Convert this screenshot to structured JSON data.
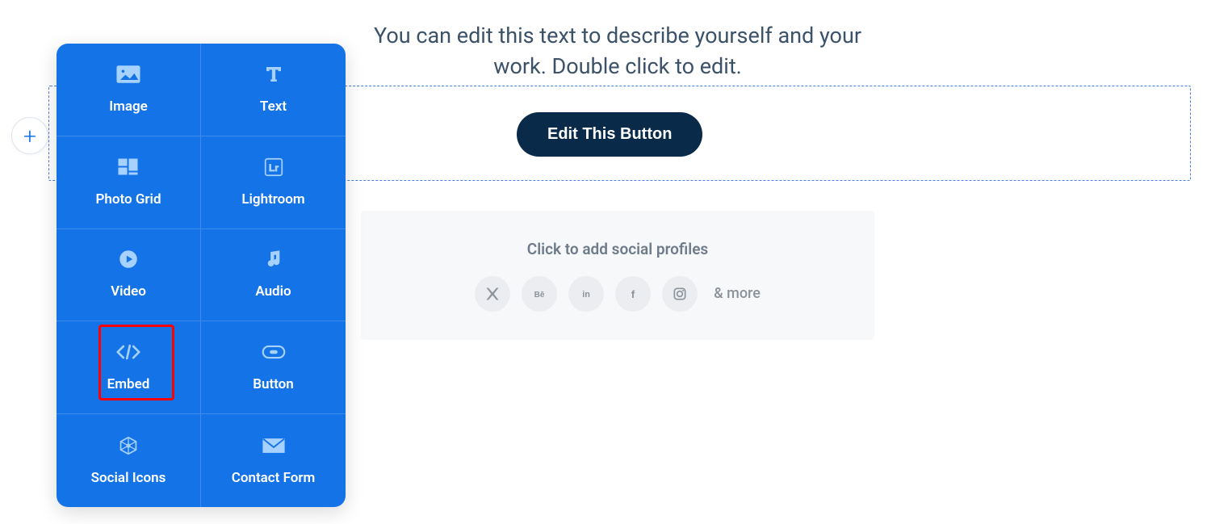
{
  "panel": {
    "items": [
      {
        "label": "Image",
        "icon": "image"
      },
      {
        "label": "Text",
        "icon": "text"
      },
      {
        "label": "Photo Grid",
        "icon": "grid"
      },
      {
        "label": "Lightroom",
        "icon": "lightroom"
      },
      {
        "label": "Video",
        "icon": "video"
      },
      {
        "label": "Audio",
        "icon": "audio"
      },
      {
        "label": "Embed",
        "icon": "embed",
        "highlighted": true
      },
      {
        "label": "Button",
        "icon": "button"
      },
      {
        "label": "Social Icons",
        "icon": "social"
      },
      {
        "label": "Contact Form",
        "icon": "contact"
      }
    ]
  },
  "main": {
    "description": "You can edit this text to describe yourself and your work. Double click to edit.",
    "button_label": "Edit This Button"
  },
  "social": {
    "title": "Click to add social profiles",
    "more_label": "& more",
    "icons": [
      "x",
      "behance",
      "linkedin",
      "facebook",
      "instagram"
    ]
  }
}
